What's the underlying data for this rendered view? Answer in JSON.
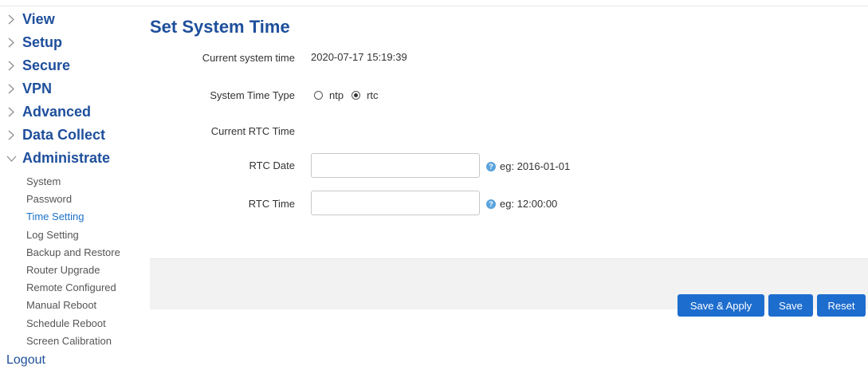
{
  "sidebar": {
    "items": [
      {
        "label": "View",
        "expanded": false
      },
      {
        "label": "Setup",
        "expanded": false
      },
      {
        "label": "Secure",
        "expanded": false
      },
      {
        "label": "VPN",
        "expanded": false
      },
      {
        "label": "Advanced",
        "expanded": false
      },
      {
        "label": "Data Collect",
        "expanded": false
      },
      {
        "label": "Administrate",
        "expanded": true
      }
    ],
    "subitems": [
      "System",
      "Password",
      "Time Setting",
      "Log Setting",
      "Backup and Restore",
      "Router Upgrade",
      "Remote Configured",
      "Manual Reboot",
      "Schedule Reboot",
      "Screen Calibration"
    ],
    "active_subitem": "Time Setting",
    "logout": "Logout"
  },
  "page": {
    "title": "Set System Time"
  },
  "form": {
    "current_time_label": "Current system time",
    "current_time_value": "2020-07-17 15:19:39",
    "type_label": "System Time Type",
    "type_options": [
      "ntp",
      "rtc"
    ],
    "type_selected": "rtc",
    "rtc_section_label": "Current RTC Time",
    "rtc_date_label": "RTC Date",
    "rtc_date_value": "",
    "rtc_date_hint": "eg: 2016-01-01",
    "rtc_time_label": "RTC Time",
    "rtc_time_value": "",
    "rtc_time_hint": "eg: 12:00:00"
  },
  "actions": {
    "save_apply": "Save & Apply",
    "save": "Save",
    "reset": "Reset"
  },
  "colors": {
    "nav_heading": "#1e4f9c",
    "active_link": "#1e73c9",
    "button": "#1d6dce",
    "action_bar": "#f2f2f2"
  }
}
